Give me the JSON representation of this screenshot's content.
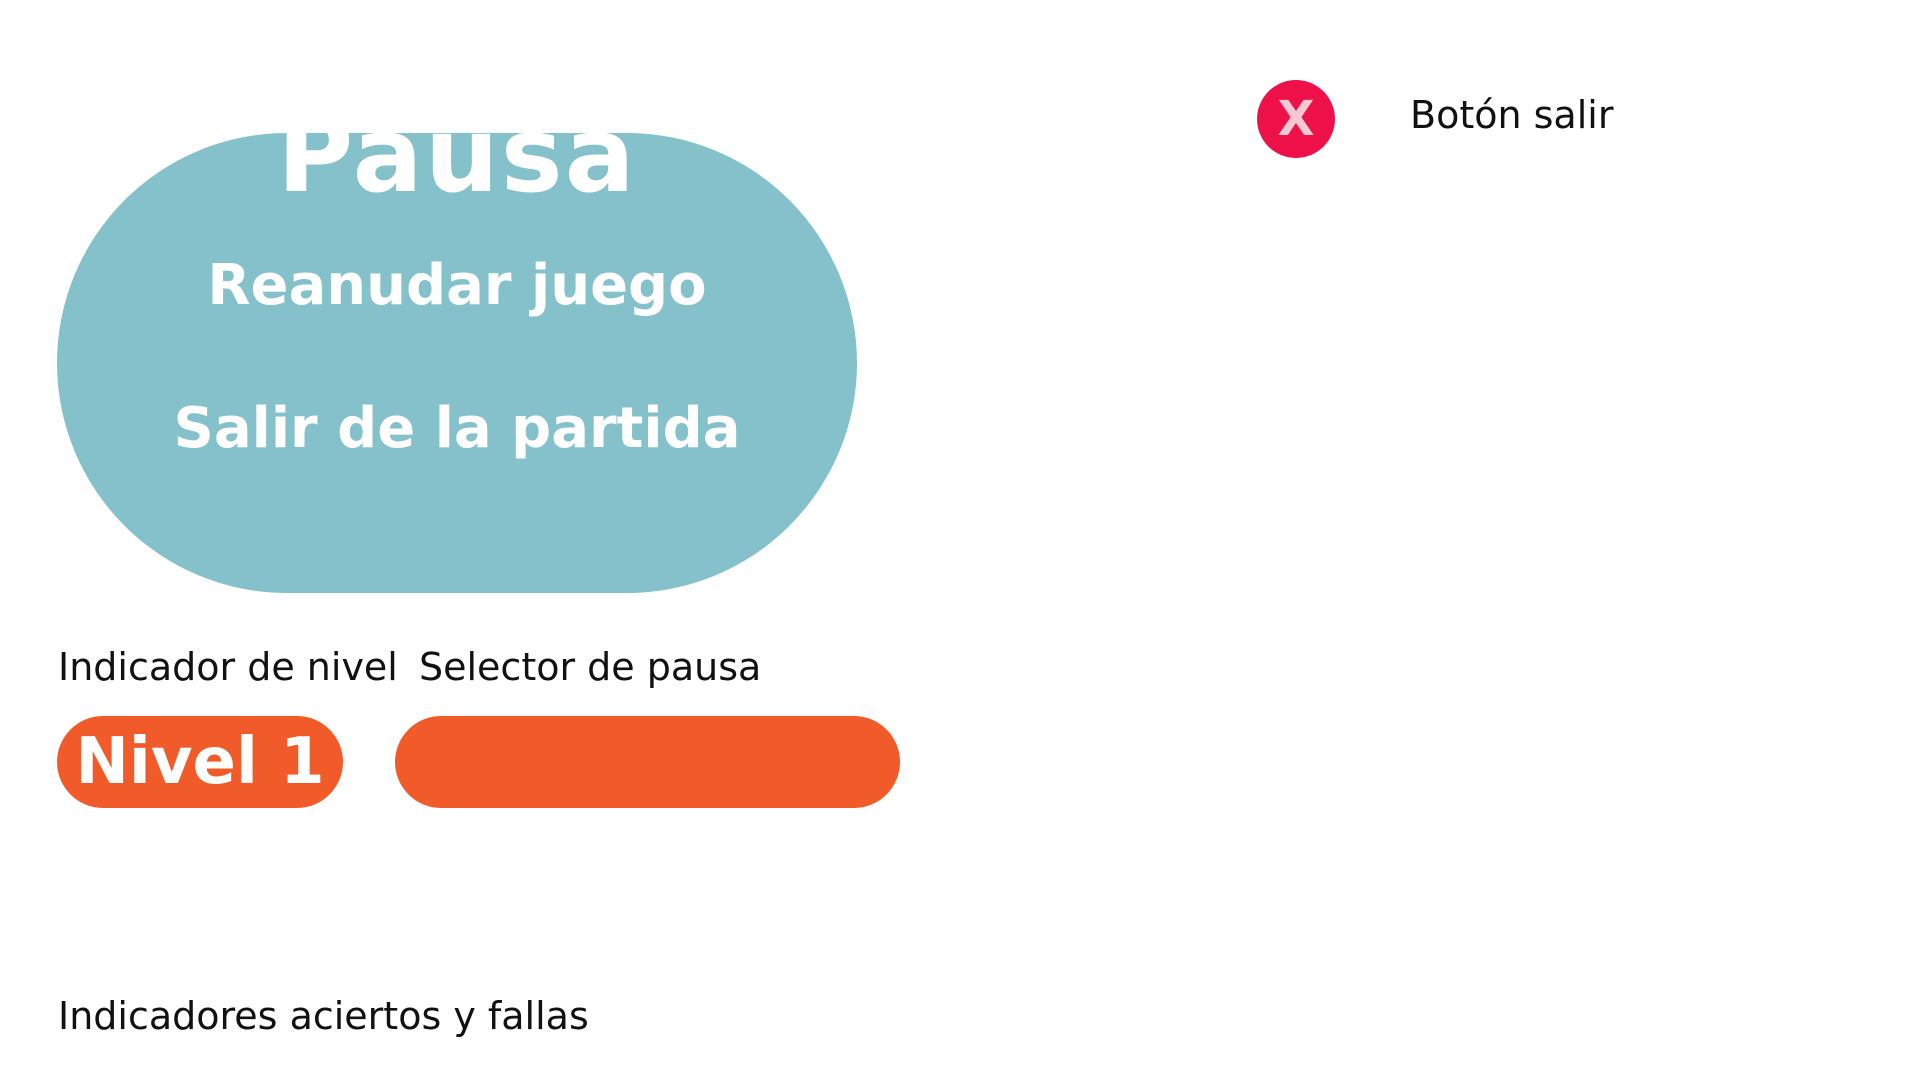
{
  "pause_menu": {
    "title": "Pausa",
    "items": [
      {
        "label": "Reanudar juego"
      },
      {
        "label": "Salir de la partida"
      }
    ],
    "panel_color": "#84c1ca"
  },
  "captions": {
    "level_indicator": "Indicador de nivel",
    "pause_selector": "Selector de pausa",
    "hits_misses": "Indicadores aciertos y fallas",
    "exit_button": "Botón salir"
  },
  "level_badge": {
    "label": "Nivel 1",
    "color": "#f15a29"
  },
  "exit_button": {
    "glyph": "X",
    "icon": "close-icon",
    "color": "#ee1149"
  }
}
